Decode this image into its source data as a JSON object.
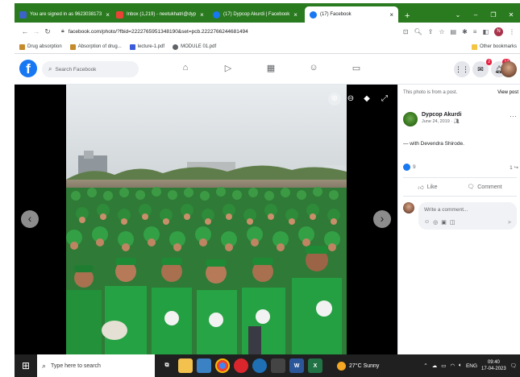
{
  "browser": {
    "tabs": [
      {
        "title": "You are signed in as 9623038173",
        "favicon_color": "#3c63c9"
      },
      {
        "title": "Inbox (1,219) - neetukhatri@dyp",
        "favicon_color": "#ea4335"
      },
      {
        "title": "(17) Dypcop Akurdi | Facebook",
        "favicon_color": "#1877f2"
      },
      {
        "title": "(17) Facebook",
        "favicon_color": "#1877f2"
      }
    ],
    "new_tab_label": "+",
    "url": "facebook.com/photo/?fbid=2222765951348190&set=pcb.2222766244681494",
    "bookmarks": [
      {
        "label": "Drug absorption",
        "color": "#c58a2b"
      },
      {
        "label": "Absorption of drug...",
        "color": "#c58a2b"
      },
      {
        "label": "lecture-1.pdf",
        "color": "#3b5bdb"
      },
      {
        "label": "MODULE 01.pdf",
        "color": "#5f6368"
      }
    ],
    "other_bookmarks": "Other bookmarks",
    "profile_initial": "N"
  },
  "facebook": {
    "search_placeholder": "Search Facebook",
    "notification_badge": "2",
    "messenger_badge": "17"
  },
  "panel": {
    "notice": "This photo is from a post.",
    "view_post": "View post",
    "author": "Dypcop Akurdi",
    "date": "June 24, 2019 · ",
    "tagline": "— with Devendra Shirode.",
    "reaction_count": "9",
    "share_count": "1 ",
    "like_label": "Like",
    "comment_label": "Comment",
    "comment_placeholder": "Write a comment..."
  },
  "taskbar": {
    "search_placeholder": "Type here to search",
    "weather": "27°C  Sunny",
    "language": "ENG",
    "time": "09:40",
    "date": "17-04-2023"
  },
  "colors": {
    "facebook_blue": "#1877f2",
    "tab_strip_green": "#2a7a1f",
    "taskbar": "#202020",
    "tshirt_green": "#25a243"
  }
}
